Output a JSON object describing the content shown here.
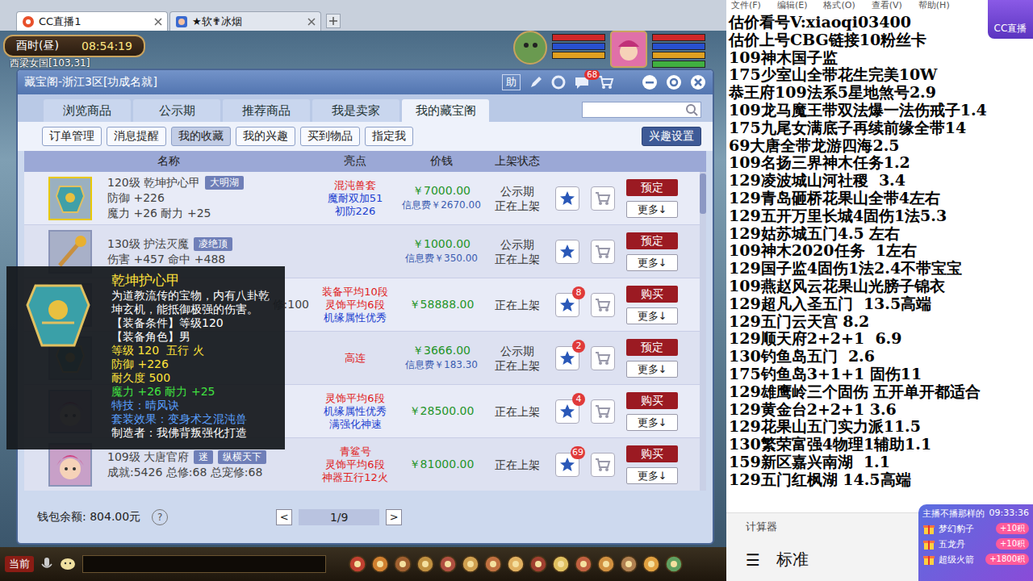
{
  "browser_tabs": [
    {
      "label": "CC直播1",
      "selected": true
    },
    {
      "label": "★软✟冰烟",
      "selected": false
    }
  ],
  "hud": {
    "time_label": "酉时(昼)",
    "time": "08:54:19",
    "location": "西梁女国[103,31]"
  },
  "dialog": {
    "title": "藏宝阁-浙江3区[功成名就]",
    "help": "助",
    "mail_badge": "68",
    "tabs": [
      {
        "label": "浏览商品",
        "selected": false
      },
      {
        "label": "公示期",
        "selected": false
      },
      {
        "label": "推荐商品",
        "selected": false
      },
      {
        "label": "我是卖家",
        "selected": false
      },
      {
        "label": "我的藏宝阁",
        "selected": true
      }
    ],
    "subtabs": [
      {
        "label": "订单管理",
        "selected": false
      },
      {
        "label": "消息提醒",
        "selected": false
      },
      {
        "label": "我的收藏",
        "selected": true
      },
      {
        "label": "我的兴趣",
        "selected": false
      },
      {
        "label": "买到物品",
        "selected": false
      },
      {
        "label": "指定我",
        "selected": false
      }
    ],
    "interest_button": "兴趣设置",
    "table": {
      "columns": [
        "名称",
        "亮点",
        "价钱",
        "上架状态"
      ],
      "rows": [
        {
          "kind": "equipment",
          "selected": true,
          "title": "120级 乾坤护心甲",
          "tags": [
            "大明湖"
          ],
          "details": [
            "防御 +226",
            "魔力 +26 耐力 +25"
          ],
          "highlights": [
            {
              "text": "混沌兽套",
              "color": "#e02020"
            },
            {
              "text": "魔耐双加51",
              "color": "#2040d0"
            },
            {
              "text": "初防226",
              "color": "#2040d0"
            }
          ],
          "price": "￥7000.00",
          "fee": "信息费￥2670.00",
          "status": [
            "公示期",
            "正在上架"
          ],
          "action": "预定",
          "more": "更多↓"
        },
        {
          "kind": "equipment",
          "selected": false,
          "title": "130级 护法灭魔",
          "tags": [
            "凌绝顶"
          ],
          "details": [
            "伤害 +457 命中 +488"
          ],
          "highlights": [],
          "price": "￥1000.00",
          "fee": "信息费￥350.00",
          "status": [
            "公示期",
            "正在上架"
          ],
          "action": "预定",
          "more": "更多↓"
        },
        {
          "kind": "role",
          "selected": false,
          "fragment": "修:100",
          "highlights": [
            {
              "text": "装备平均10段",
              "color": "#e02020"
            },
            {
              "text": "灵饰平均6段",
              "color": "#e02020"
            },
            {
              "text": "机缘属性优秀",
              "color": "#2040d0"
            }
          ],
          "price": "￥58888.00",
          "status": [
            "正在上架"
          ],
          "fav_badge": "8",
          "action": "购买",
          "more": "更多↓"
        },
        {
          "kind": "equipment",
          "selected": false,
          "highlights": [
            {
              "text": "高连",
              "color": "#e02020"
            }
          ],
          "price": "￥3666.00",
          "fee": "信息费￥183.30",
          "status": [
            "公示期",
            "正在上架"
          ],
          "fav_badge": "2",
          "action": "预定",
          "more": "更多↓"
        },
        {
          "kind": "role",
          "selected": false,
          "highlights": [
            {
              "text": "灵饰平均6段",
              "color": "#e02020"
            },
            {
              "text": "机缘属性优秀",
              "color": "#2040d0"
            },
            {
              "text": "满强化神速",
              "color": "#2040d0"
            }
          ],
          "price": "￥28500.00",
          "status": [
            "正在上架"
          ],
          "fav_badge": "4",
          "action": "购买",
          "more": "更多↓"
        },
        {
          "kind": "role",
          "selected": false,
          "title": "109级 大唐官府",
          "tags": [
            "迷",
            "纵横天下"
          ],
          "details": [
            "成就:5426 总修:68 总宠修:68"
          ],
          "highlights": [
            {
              "text": "青鲨号",
              "color": "#e02020"
            },
            {
              "text": "灵饰平均6段",
              "color": "#e02020"
            },
            {
              "text": "神器五行12火",
              "color": "#e02020"
            }
          ],
          "price": "￥81000.00",
          "status": [
            "正在上架"
          ],
          "fav_badge": "69",
          "action": "购买",
          "more": "更多↓"
        }
      ]
    },
    "footer": {
      "balance": "钱包余额: 804.00元",
      "help": "?",
      "prev": "<",
      "page": "1/9",
      "next": ">"
    }
  },
  "tooltip": {
    "title": "乾坤护心甲",
    "description": "为道教流传的宝物，内有八卦乾坤玄机，能抵御极强的伤害。",
    "lines": [
      {
        "text": "【装备条件】等级120",
        "color": "#ffffff"
      },
      {
        "text": "【装备角色】男",
        "color": "#ffffff"
      },
      {
        "text": "等级 120  五行 火",
        "color": "#ffe23a"
      },
      {
        "text": "防御 +226",
        "color": "#ffe23a"
      },
      {
        "text": "耐久度 500",
        "color": "#ffe23a"
      },
      {
        "text": "魔力 +26 耐力 +25",
        "color": "#40e040"
      },
      {
        "text": "特技：晴风诀",
        "color": "#5aa0ff"
      },
      {
        "text": "套装效果：变身术之混沌兽",
        "color": "#5aa0ff"
      },
      {
        "text": "制造者：我佛背叛强化打造",
        "color": "#ffffff"
      }
    ]
  },
  "chat": {
    "channel": "当前"
  },
  "right_menu": [
    "文件(F)",
    "编辑(E)",
    "格式(O)",
    "查看(V)",
    "帮助(H)"
  ],
  "cc_logo": "CC直播",
  "notes": {
    "lines": [
      "估价看号V:xiaoqi03400",
      "估价上号CBG链接10粉丝卡",
      "109神木国子监",
      "175少室山全带花生完美10W",
      "恭王府109法系5星地煞号2.9",
      "109龙马魔王带双法爆一法伤戒子1.4",
      "175九尾女满底子再续前缘全带14",
      "69大唐全带龙游四海2.5",
      "109名扬三界神木任务1.2",
      "129凌波城山河社稷  3.4",
      "129青岛砸桥花果山全带4左右",
      "129五开万里长城4固伤1法5.3",
      "129姑苏城五门4.5 左右",
      "109神木2020任务  1左右",
      "129国子监4固伤1法2.4不带宝宝",
      "109燕赵风云花果山光膀子锦衣",
      "129超凡入圣五门  13.5高端",
      "129五门云天宫 8.2",
      "129顺天府2+2+1  6.9",
      "130钓鱼岛五门  2.6",
      "175钓鱼岛3+1+1 固伤11",
      "129雄鹰岭三个固伤 五开单开都适合",
      "129黄金台2+2+1 3.6",
      "129花果山五门实力派11.5",
      "130繁荣富强4物理1辅助1.1",
      "159新区嘉兴南湖  1.1",
      "129五门红枫湖 14.5高端"
    ]
  },
  "calculator": {
    "title": "计算器",
    "menu_icon": "☰",
    "mode": "标准"
  },
  "gift_panel": {
    "banner": "主播不播那样的",
    "time": "09:33:36",
    "gifts": [
      {
        "name": "梦幻豹子",
        "points": "+10积"
      },
      {
        "name": "五龙丹",
        "points": "+10积"
      },
      {
        "name": "超级火箭",
        "points": "+1800积"
      }
    ]
  }
}
